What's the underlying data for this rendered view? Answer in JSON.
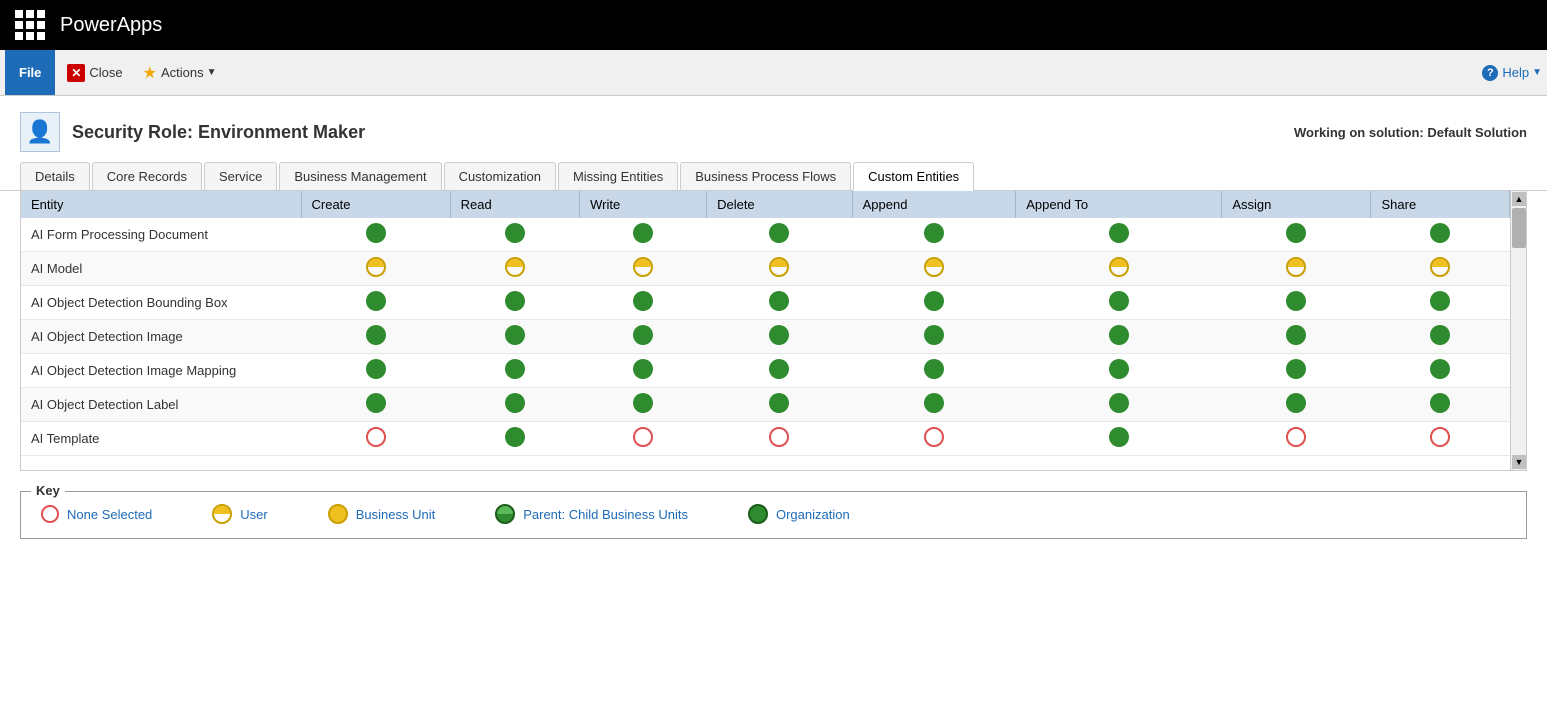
{
  "topbar": {
    "app_title": "PowerApps"
  },
  "toolbar": {
    "file_label": "File",
    "close_label": "Close",
    "actions_label": "Actions",
    "help_label": "Help"
  },
  "page": {
    "title": "Security Role: Environment Maker",
    "solution_text": "Working on solution: Default Solution"
  },
  "tabs": [
    {
      "id": "details",
      "label": "Details",
      "active": false
    },
    {
      "id": "core-records",
      "label": "Core Records",
      "active": false
    },
    {
      "id": "service",
      "label": "Service",
      "active": false
    },
    {
      "id": "business-management",
      "label": "Business Management",
      "active": false
    },
    {
      "id": "customization",
      "label": "Customization",
      "active": false
    },
    {
      "id": "missing-entities",
      "label": "Missing Entities",
      "active": false
    },
    {
      "id": "business-process-flows",
      "label": "Business Process Flows",
      "active": false
    },
    {
      "id": "custom-entities",
      "label": "Custom Entities",
      "active": true
    }
  ],
  "table": {
    "columns": [
      "Entity",
      "Create",
      "Read",
      "Write",
      "Delete",
      "Append",
      "Append To",
      "Assign",
      "Share"
    ],
    "rows": [
      {
        "entity": "AI Form Processing Document",
        "create": "green",
        "read": "green",
        "write": "green",
        "delete": "green",
        "append": "green",
        "appendto": "green",
        "assign": "green",
        "share": "green"
      },
      {
        "entity": "AI Model",
        "create": "yellow",
        "read": "yellow",
        "write": "yellow",
        "delete": "yellow",
        "append": "yellow",
        "appendto": "yellow",
        "assign": "yellow",
        "share": "yellow"
      },
      {
        "entity": "AI Object Detection Bounding Box",
        "create": "green",
        "read": "green",
        "write": "green",
        "delete": "green",
        "append": "green",
        "appendto": "green",
        "assign": "green",
        "share": "green"
      },
      {
        "entity": "AI Object Detection Image",
        "create": "green",
        "read": "green",
        "write": "green",
        "delete": "green",
        "append": "green",
        "appendto": "green",
        "assign": "green",
        "share": "green"
      },
      {
        "entity": "AI Object Detection Image Mapping",
        "create": "green",
        "read": "green",
        "write": "green",
        "delete": "green",
        "append": "green",
        "appendto": "green",
        "assign": "green",
        "share": "green"
      },
      {
        "entity": "AI Object Detection Label",
        "create": "green",
        "read": "green",
        "write": "green",
        "delete": "green",
        "append": "green",
        "appendto": "green",
        "assign": "green",
        "share": "green"
      },
      {
        "entity": "AI Template",
        "create": "empty",
        "read": "green",
        "write": "empty",
        "delete": "empty",
        "append": "empty",
        "appendto": "green",
        "assign": "empty",
        "share": "empty"
      }
    ]
  },
  "key": {
    "title": "Key",
    "items": [
      {
        "type": "empty",
        "label": "None Selected"
      },
      {
        "type": "yellow-half",
        "label": "User"
      },
      {
        "type": "yellow-full",
        "label": "Business Unit"
      },
      {
        "type": "green-partial",
        "label": "Parent: Child Business Units"
      },
      {
        "type": "green",
        "label": "Organization"
      }
    ]
  }
}
